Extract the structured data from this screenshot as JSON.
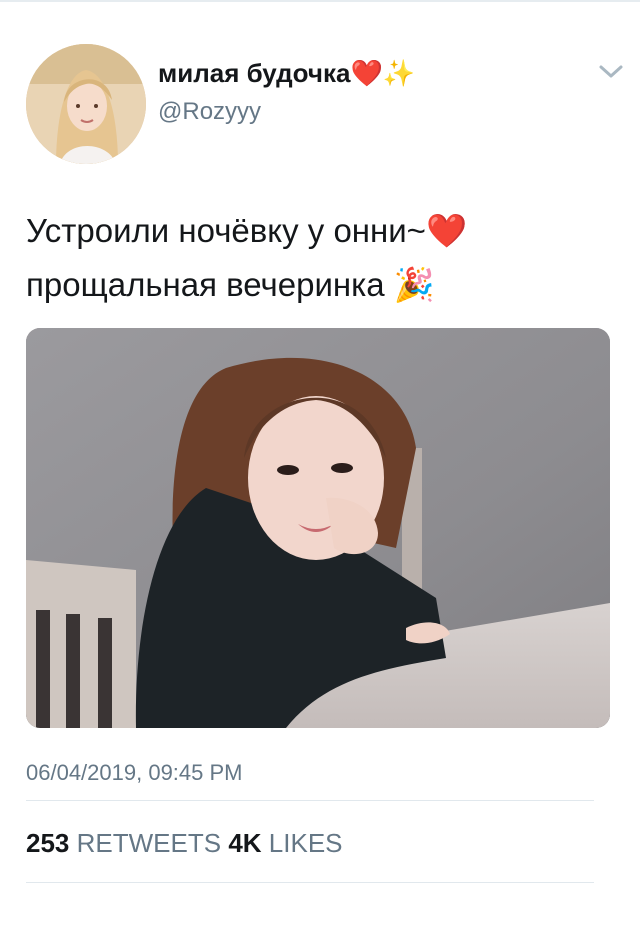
{
  "user": {
    "display_name": "милая будочка",
    "name_emojis": [
      "❤️",
      "✨"
    ],
    "handle": "@Rozyyy"
  },
  "tweet": {
    "lines": [
      "Устроили ночёвку у онни~",
      "прощальная вечеринка"
    ],
    "line_emojis": [
      "❤️",
      "🎉"
    ],
    "timestamp": "06/04/2019, 09:45 PM"
  },
  "stats": {
    "retweets_count": "253",
    "retweets_label": "RETWEETS",
    "likes_count": "4K",
    "likes_label": "LIKES"
  },
  "icons": [
    "chevron-down-icon",
    "heart-emoji",
    "sparkles-emoji",
    "party-popper-emoji"
  ],
  "colors": {
    "primary_text": "#14171a",
    "secondary_text": "#657786",
    "divider": "#e1e8ed",
    "heart": "#e0102b"
  }
}
